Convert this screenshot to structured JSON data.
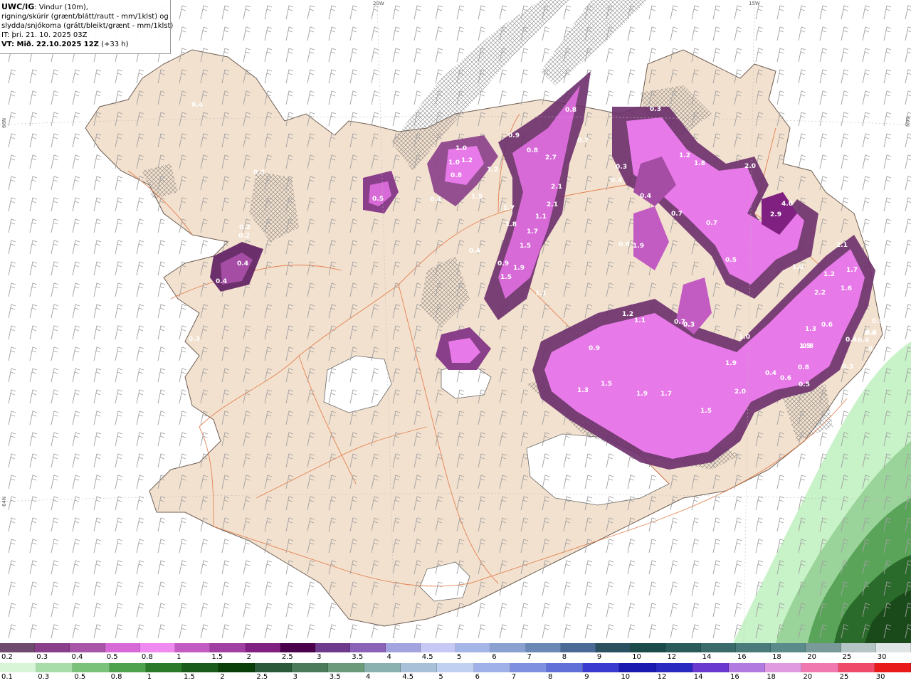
{
  "header": {
    "model": "UWC/IG",
    "variable_line1": ": Vindur (10m),",
    "variable_line2": "rigning/skúrir (grænt/blátt/rautt - mm/1klst) og",
    "variable_line3": "slydda/snjókoma (grátt/bleikt/grænt - mm/1klst)",
    "init_time": "IT: þri. 21. 10. 2025 03Z",
    "valid_prefix": "VT: Mið. 22.10.2025 12Z",
    "valid_suffix": " (+33 h)"
  },
  "grid_labels": {
    "lon_20w": "20W",
    "lon_15w": "15W",
    "lat_66n_left": "66N",
    "lat_66n_right": "66N",
    "lat_64n_left": "64N"
  },
  "colors": {
    "land": "#f3e1cf",
    "land_edge": "#7a6a60",
    "ice": "#ffffff",
    "roads": "#e0703a",
    "snow_dark": "#6b2f6b",
    "snow_mid": "#a54da5",
    "snow_light": "#e879e8",
    "rain_light": "#c8f2c8",
    "rain_mid": "#5aa45a",
    "rain_dark": "#1e5a2a",
    "wind_barb": "#9a9a9a"
  },
  "precip_labels": [
    "0.4",
    "0.3",
    "0.2",
    "0.4",
    "0.4",
    "0.3",
    "0.2",
    "0.5",
    "0.4",
    "1.0",
    "1.0",
    "1.2",
    "0.8",
    "1.5",
    "0.9",
    "0.8",
    "2.7",
    "0.8",
    "0.7",
    "1.2",
    "2.1",
    "2.1",
    "1.1",
    "1.7",
    "1.8",
    "1.7",
    "0.4",
    "1.5",
    "0.9",
    "1.9",
    "1.5",
    "1.1",
    "0.3",
    "1.2",
    "1.8",
    "2.0",
    "0.3",
    "0.4",
    "0.4",
    "0.7",
    "0.6",
    "1.9",
    "0.7",
    "0.5",
    "2.9",
    "4.0",
    "2.1",
    "1.0",
    "1.2",
    "1.7",
    "2.2",
    "1.6",
    "0.7",
    "1.2",
    "1.1",
    "0.3",
    "1.0",
    "1.3",
    "0.6",
    "0.6",
    "0.5",
    "0.0",
    "0.4",
    "0.4",
    "0.5",
    "0.8",
    "1.5",
    "1.9",
    "0.4",
    "0.6",
    "0.5",
    "0.8",
    "0.3",
    "1.3",
    "1.5",
    "1.9",
    "1.7",
    "1.5",
    "2.0",
    "0.9",
    "0.3"
  ],
  "snow_scale": {
    "labels": [
      "0.2",
      "0.3",
      "0.4",
      "0.5",
      "0.8",
      "1",
      "1.5",
      "2",
      "2.5",
      "3",
      "3.5",
      "4",
      "4.5",
      "5",
      "6",
      "7",
      "8",
      "9",
      "10",
      "12",
      "14",
      "16",
      "18",
      "20",
      "25",
      "30"
    ],
    "colors": [
      "#6e4a6e",
      "#8a3f8a",
      "#a855a8",
      "#d86ad8",
      "#f08af0",
      "#c25bc2",
      "#a23fa2",
      "#802080",
      "#4a004a",
      "#6e3a8c",
      "#8a62b8",
      "#a3a3e0",
      "#c8c8f5",
      "#a5b5e5",
      "#8aa0d0",
      "#6a88b5",
      "#4a6a95",
      "#2a5060",
      "#1a4a4a",
      "#2a5a5a",
      "#3a6a6a",
      "#4a7a7a",
      "#5a8a8a",
      "#7a9a9a",
      "#b5c5c5",
      "#e0e5e5"
    ]
  },
  "rain_scale": {
    "labels": [
      "0.1",
      "0.3",
      "0.5",
      "0.8",
      "1",
      "1.5",
      "2",
      "2.5",
      "3",
      "3.5",
      "4",
      "4.5",
      "5",
      "6",
      "7",
      "8",
      "9",
      "10",
      "12",
      "14",
      "16",
      "18",
      "20",
      "25",
      "30"
    ],
    "colors": [
      "#d8f5d8",
      "#a8dca8",
      "#7ac27a",
      "#4ea24e",
      "#2a7a2a",
      "#1a5a1a",
      "#0a3f0a",
      "#2a5a3a",
      "#4a7a5a",
      "#6a9a7a",
      "#8ab0b0",
      "#a8c0d8",
      "#c0d0f0",
      "#a0b0e8",
      "#8090e0",
      "#6070d8",
      "#3a3ad0",
      "#1a1ab0",
      "#2a2ac0",
      "#6a3ad0",
      "#b07ae0",
      "#e09ae0",
      "#f07ab0",
      "#f04a6a",
      "#e81a1a"
    ]
  }
}
